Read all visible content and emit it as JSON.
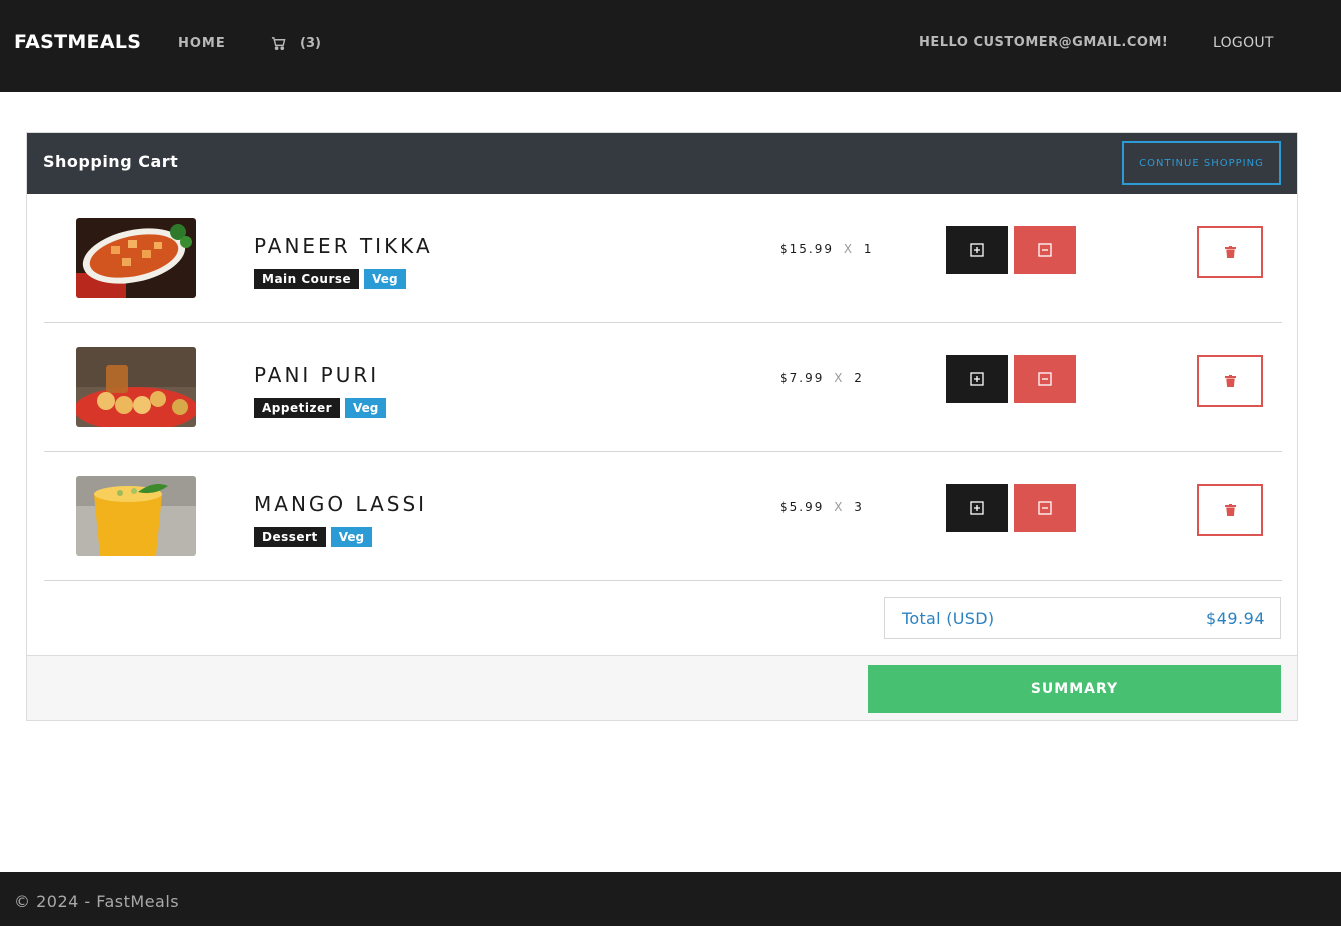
{
  "nav": {
    "brand": "FASTMEALS",
    "home": "HOME",
    "cart_count": "(3)",
    "hello": "HELLO CUSTOMER@GMAIL.COM!",
    "logout": "LOGOUT"
  },
  "cart": {
    "title": "Shopping Cart",
    "continue_label": "CONTINUE SHOPPING",
    "items": [
      {
        "name": "PANEER TIKKA",
        "category": "Main Course",
        "diet": "Veg",
        "price": "$15.99",
        "x": "X",
        "qty": "1"
      },
      {
        "name": "PANI PURI",
        "category": "Appetizer",
        "diet": "Veg",
        "price": "$7.99",
        "x": "X",
        "qty": "2"
      },
      {
        "name": "MANGO LASSI",
        "category": "Dessert",
        "diet": "Veg",
        "price": "$5.99",
        "x": "X",
        "qty": "3"
      }
    ],
    "total_label": "Total (USD)",
    "total_value": "$49.94",
    "summary_label": "SUMMARY"
  },
  "footer": {
    "text": "© 2024 - FastMeals"
  },
  "colors": {
    "navbar": "#1b1b1c",
    "header": "#343a40",
    "accent_blue": "#2b9bd6",
    "danger": "#dc5450",
    "success": "#48c072"
  }
}
